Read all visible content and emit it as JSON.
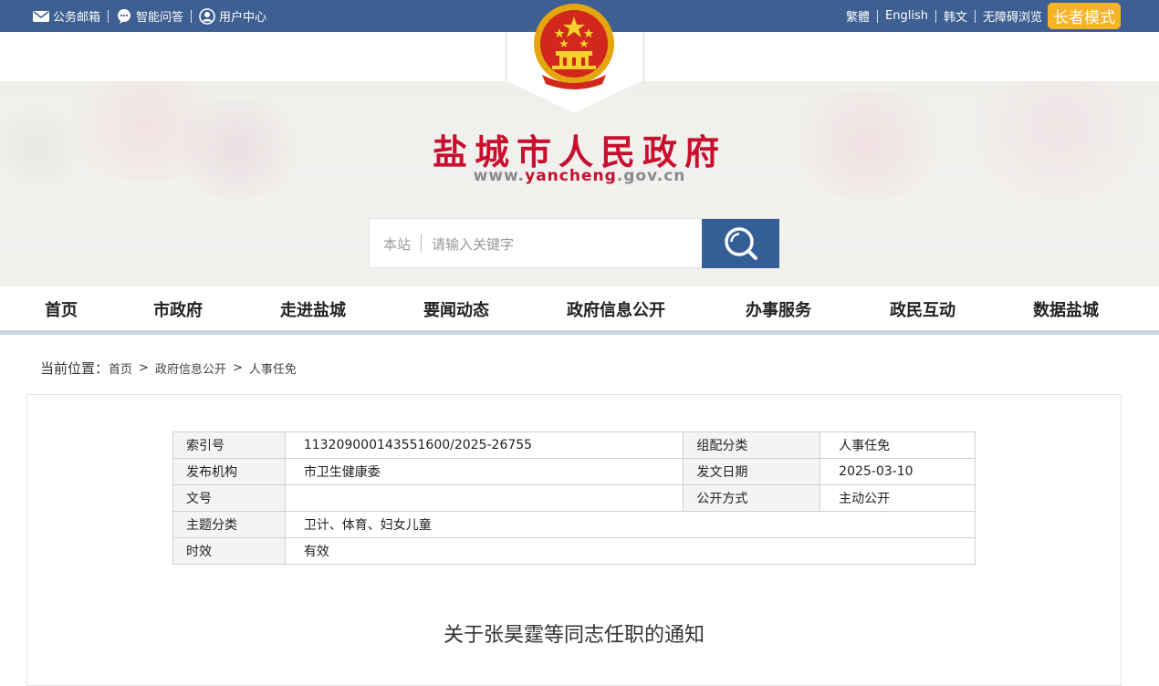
{
  "topbar": {
    "left": [
      {
        "icon": "mail-icon",
        "label": "公务邮箱"
      },
      {
        "icon": "chat-icon",
        "label": "智能问答"
      },
      {
        "icon": "user-icon",
        "label": "用户中心"
      }
    ],
    "right": [
      "繁體",
      "English",
      "韩文",
      "无障碍浏览"
    ],
    "elder_mode": "长者模式"
  },
  "header": {
    "emblem_icon": "national-emblem-icon",
    "site_title": "盐城市人民政府",
    "url_prefix": "www.",
    "url_highlight": "yancheng",
    "url_suffix": ".gov.cn"
  },
  "search": {
    "scope": "本站",
    "placeholder": "请输入关键字",
    "button_icon": "search-icon"
  },
  "nav": [
    "首页",
    "市政府",
    "走进盐城",
    "要闻动态",
    "政府信息公开",
    "办事服务",
    "政民互动",
    "数据盐城"
  ],
  "breadcrumb": {
    "label": "当前位置：",
    "items": [
      "首页",
      "政府信息公开",
      "人事任免"
    ],
    "separator": ">"
  },
  "meta": {
    "index_label": "索引号",
    "index_value": "113209000143551600/2025-26755",
    "category_label": "组配分类",
    "category_value": "人事任免",
    "publisher_label": "发布机构",
    "publisher_value": "市卫生健康委",
    "date_label": "发文日期",
    "date_value": "2025-03-10",
    "docno_label": "文号",
    "docno_value": "",
    "mode_label": "公开方式",
    "mode_value": "主动公开",
    "topic_label": "主题分类",
    "topic_value": "卫计、体育、妇女儿童",
    "validity_label": "时效",
    "validity_value": "有效"
  },
  "document": {
    "title": "关于张昊霆等同志任职的通知"
  },
  "colors": {
    "topbar_bg": "#3d5f92",
    "title_red": "#c8102e",
    "search_btn": "#345e96",
    "elder_badge": "#f5b325",
    "nav_underline": "#c9d5e6"
  }
}
